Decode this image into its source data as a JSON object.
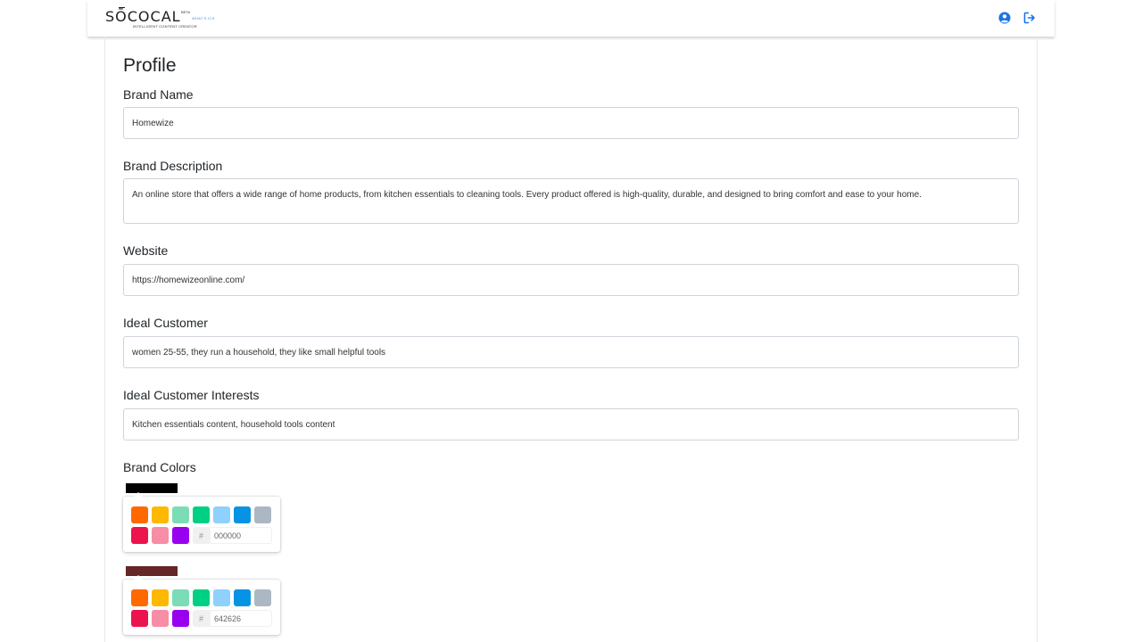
{
  "brand": {
    "logo_text": "SŌCOCAL",
    "logo_tagline": "INTELLIGENT CONTENT CREATOR",
    "logo_beta": "BETA",
    "logo_tag": "WHAT'S ICS"
  },
  "nav": {
    "account_icon": "user-circle-icon",
    "logout_icon": "sign-out-icon",
    "accent": "#1a73e8"
  },
  "page": {
    "title": "Profile"
  },
  "fields": {
    "brand_name": {
      "label": "Brand Name",
      "value": "Homewize"
    },
    "brand_description": {
      "label": "Brand Description",
      "value": "An online store that offers a wide range of home products, from kitchen essentials to cleaning tools. Every product offered is high-quality, durable, and designed to bring comfort and ease to your home."
    },
    "website": {
      "label": "Website",
      "value": "https://homewizeonline.com/"
    },
    "ideal_customer": {
      "label": "Ideal Customer",
      "value": "women 25-55, they run a household, they like small helpful tools"
    },
    "ideal_customer_interests": {
      "label": "Ideal Customer Interests",
      "value": "Kitchen essentials content, household tools content"
    }
  },
  "brand_colors": {
    "label": "Brand Colors",
    "hash_symbol": "#",
    "palette": [
      "#ff6900",
      "#fcb900",
      "#7bdcb5",
      "#00d084",
      "#8ed1fc",
      "#0693e3",
      "#abb8c3",
      "#eb144c",
      "#f78da7",
      "#9900ef"
    ],
    "pickers": [
      {
        "color": "#000000",
        "hex": "000000"
      },
      {
        "color": "#642626",
        "hex": "642626"
      }
    ]
  }
}
